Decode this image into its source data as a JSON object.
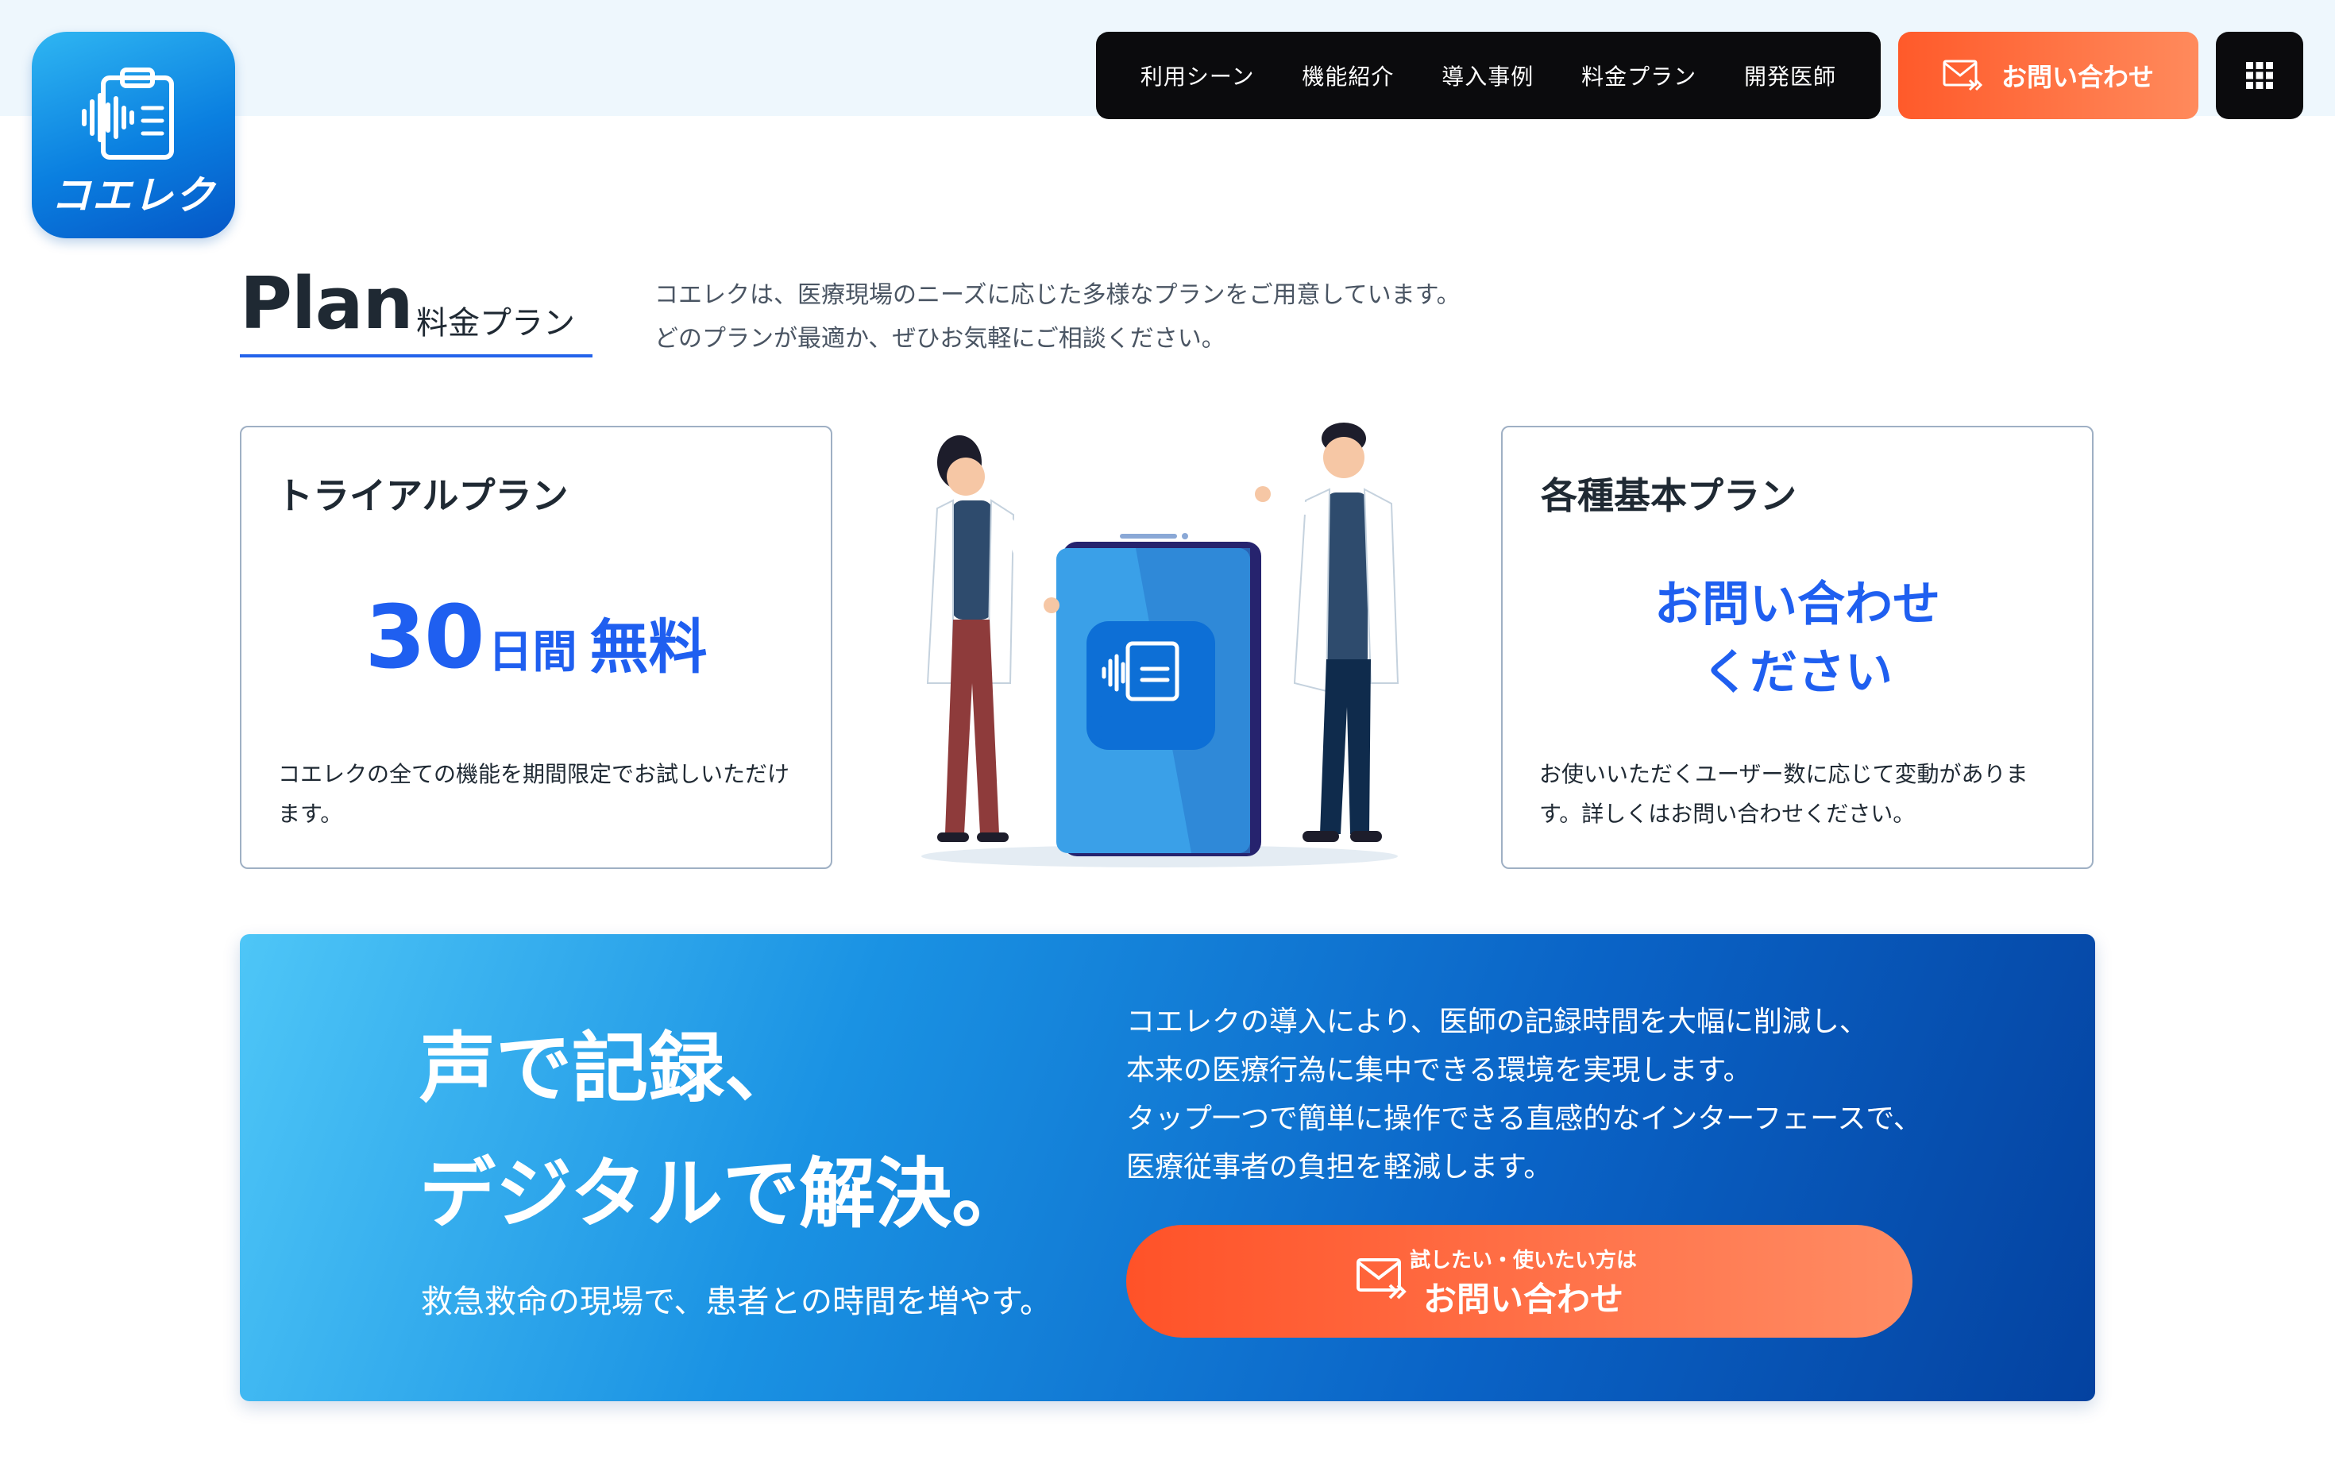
{
  "brand": {
    "logo_text": "コエレク"
  },
  "nav": {
    "items": [
      {
        "label": "利用シーン"
      },
      {
        "label": "機能紹介"
      },
      {
        "label": "導入事例"
      },
      {
        "label": "料金プラン"
      },
      {
        "label": "開発医師"
      }
    ],
    "contact_label": "お問い合わせ",
    "menu_icon": "grid-icon"
  },
  "plan_section": {
    "title": "Plan",
    "subtitle": "料金プラン",
    "intro_line1": "コエレクは、医療現場のニーズに応じた多様なプランをご用意しています。",
    "intro_line2": "どのプランが最適か、ぜひお気軽にご相談ください。"
  },
  "cards": {
    "trial": {
      "title": "トライアルプラン",
      "amount_number": "30",
      "amount_unit": "日間",
      "amount_free": "無料",
      "description": "コエレクの全ての機能を期間限定でお試しいただけます。"
    },
    "basic": {
      "title": "各種基本プラン",
      "ask_line1": "お問い合わせ",
      "ask_line2": "ください",
      "description": "お使いいただくユーザー数に応じて変動があります。詳しくはお問い合わせください。"
    }
  },
  "illustration": {
    "app_label": "コエレク"
  },
  "banner": {
    "headline_line1": "声で記録、",
    "headline_line2": "デジタルで解決。",
    "tagline": "救急救命の現場で、患者との時間を増やす。",
    "body_line1": "コエレクの導入により、医師の記録時間を大幅に削減し、",
    "body_line2": "本来の医療行為に集中できる環境を実現します。",
    "body_line3": "タップ一つで簡単に操作できる直感的なインターフェースで、",
    "body_line4": "医療従事者の負担を軽減します。",
    "cta_small": "試したい・使いたい方は",
    "cta_main": "お問い合わせ"
  },
  "colors": {
    "accent_blue": "#1f5ff0",
    "cta_orange": "#ff5a2a",
    "nav_bg": "#0b0b0d",
    "top_band": "#eef7fd"
  }
}
